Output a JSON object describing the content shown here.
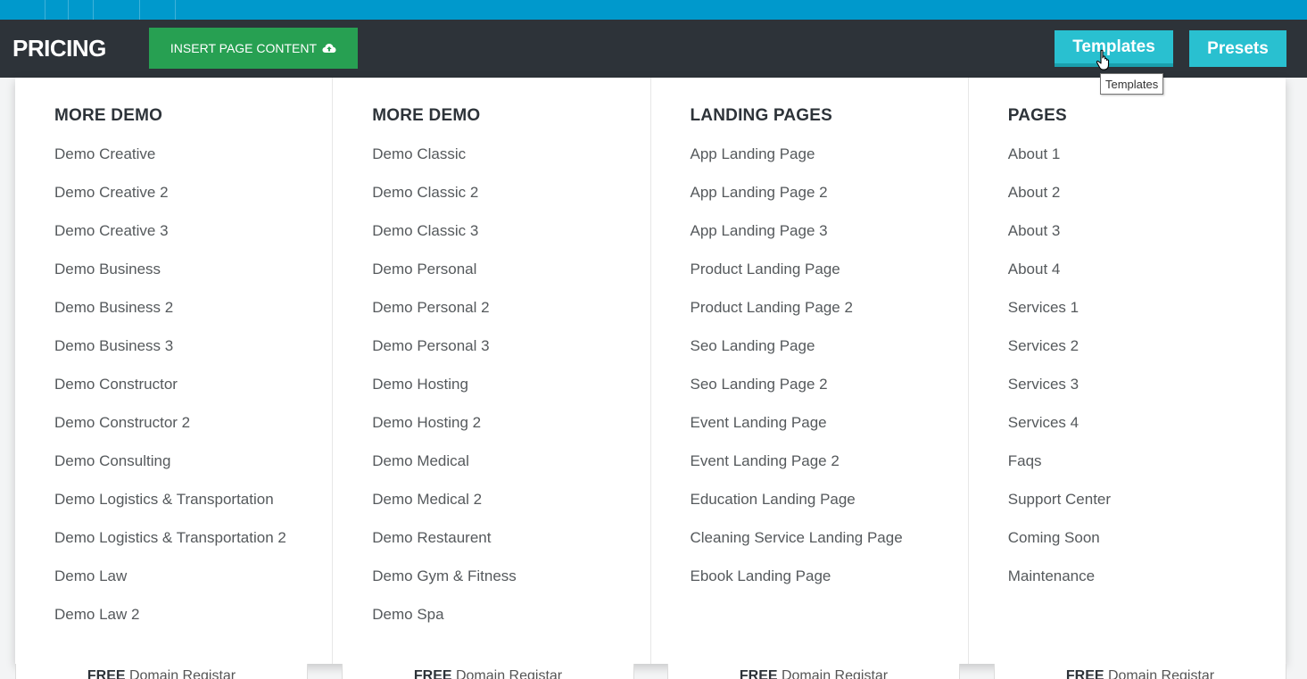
{
  "toolbar": {
    "page_title": "PRICING",
    "insert_label": "INSERT PAGE CONTENT",
    "templates_label": "Templates",
    "presets_label": "Presets",
    "tooltip": "Templates"
  },
  "colors": {
    "top_strip": "#0099cc",
    "toolbar_bg": "#2d3339",
    "insert_green": "#27a052",
    "tab_cyan": "#29c0d0"
  },
  "columns": [
    {
      "heading": "MORE DEMO",
      "items": [
        "Demo Creative",
        "Demo Creative 2",
        "Demo Creative 3",
        "Demo Business",
        "Demo Business 2",
        "Demo Business 3",
        "Demo Constructor",
        "Demo Constructor 2",
        "Demo Consulting",
        "Demo Logistics & Transportation",
        "Demo Logistics & Transportation 2",
        "Demo Law",
        "Demo Law 2"
      ]
    },
    {
      "heading": "MORE DEMO",
      "items": [
        "Demo Classic",
        "Demo Classic 2",
        "Demo Classic 3",
        "Demo Personal",
        "Demo Personal 2",
        "Demo Personal 3",
        "Demo Hosting",
        "Demo Hosting 2",
        "Demo Medical",
        "Demo Medical 2",
        "Demo Restaurent",
        "Demo Gym & Fitness",
        "Demo Spa"
      ]
    },
    {
      "heading": "LANDING PAGES",
      "items": [
        "App Landing Page",
        "App Landing Page 2",
        "App Landing Page 3",
        "Product Landing Page",
        "Product Landing Page 2",
        "Seo Landing Page",
        "Seo Landing Page 2",
        "Event Landing Page",
        "Event Landing Page 2",
        "Education Landing Page",
        "Cleaning Service Landing Page",
        "Ebook Landing Page"
      ]
    },
    {
      "heading": "PAGES",
      "items": [
        "About 1",
        "About 2",
        "About 3",
        "About 4",
        "Services 1",
        "Services 2",
        "Services 3",
        "Services 4",
        "Faqs",
        "Support Center",
        "Coming Soon",
        "Maintenance"
      ]
    }
  ],
  "cards": [
    {
      "strong": "FREE",
      "text": " Domain Registar"
    },
    {
      "strong": "FREE",
      "text": " Domain Registar"
    },
    {
      "strong": "FREE",
      "text": " Domain Registar"
    },
    {
      "strong": "FREE",
      "text": " Domain Registar"
    }
  ]
}
